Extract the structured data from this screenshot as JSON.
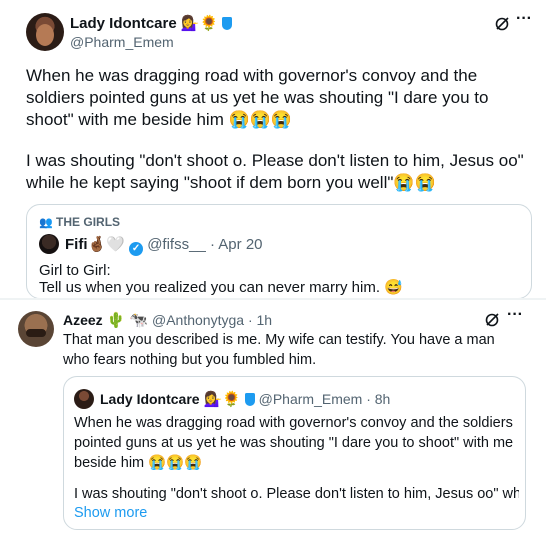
{
  "main_tweet": {
    "display_name": "Lady Idontcare",
    "name_emojis": "💁‍♀️🌻",
    "handle": "@Pharm_Emem",
    "paragraph1": "When he was dragging road with governor's convoy and the soldiers pointed guns at us yet he was shouting \"I dare you to shoot\" with me beside him 😭😭😭",
    "paragraph2": "I was shouting \"don't shoot o. Please don't listen to him, Jesus oo\" while he kept saying \"shoot if dem born you well\"😭😭",
    "more_label": "···"
  },
  "quoted_tweet": {
    "community": "THE GIRLS",
    "display_name": "Fifi",
    "name_emojis": "🤞🏾🤍",
    "handle": "@fifss__",
    "time": "· Apr 20",
    "line1": "Girl to Girl:",
    "line2": "Tell us when you realized you can never marry him. 😅"
  },
  "reply_tweet": {
    "display_name": "Azeez",
    "name_emojis": "🌵 🐄",
    "handle": "@Anthonytyga",
    "time": "· 1h",
    "text": "That man you described is me. My wife can testify. You have a man who fears nothing but you fumbled him.",
    "more_label": "···"
  },
  "reply_quote": {
    "display_name": "Lady Idontcare",
    "name_emojis": "💁‍♀️🌻",
    "handle": "@Pharm_Emem",
    "time": "· 8h",
    "paragraph1": "When he was dragging road with governor's convoy and the soldiers pointed guns at us yet he was shouting \"I dare you to shoot\" with me beside him 😭😭😭",
    "paragraph2": "I was shouting \"don't shoot o. Please don't listen to him, Jesus oo\" whil...",
    "show_more": "Show more"
  },
  "colors": {
    "text": "#0f1419",
    "muted": "#536471",
    "link": "#1d9bf0",
    "border": "#cfd9de"
  },
  "icons": [
    "grok-icon",
    "more-icon",
    "verified-icon",
    "community-icon",
    "shield-icon"
  ]
}
